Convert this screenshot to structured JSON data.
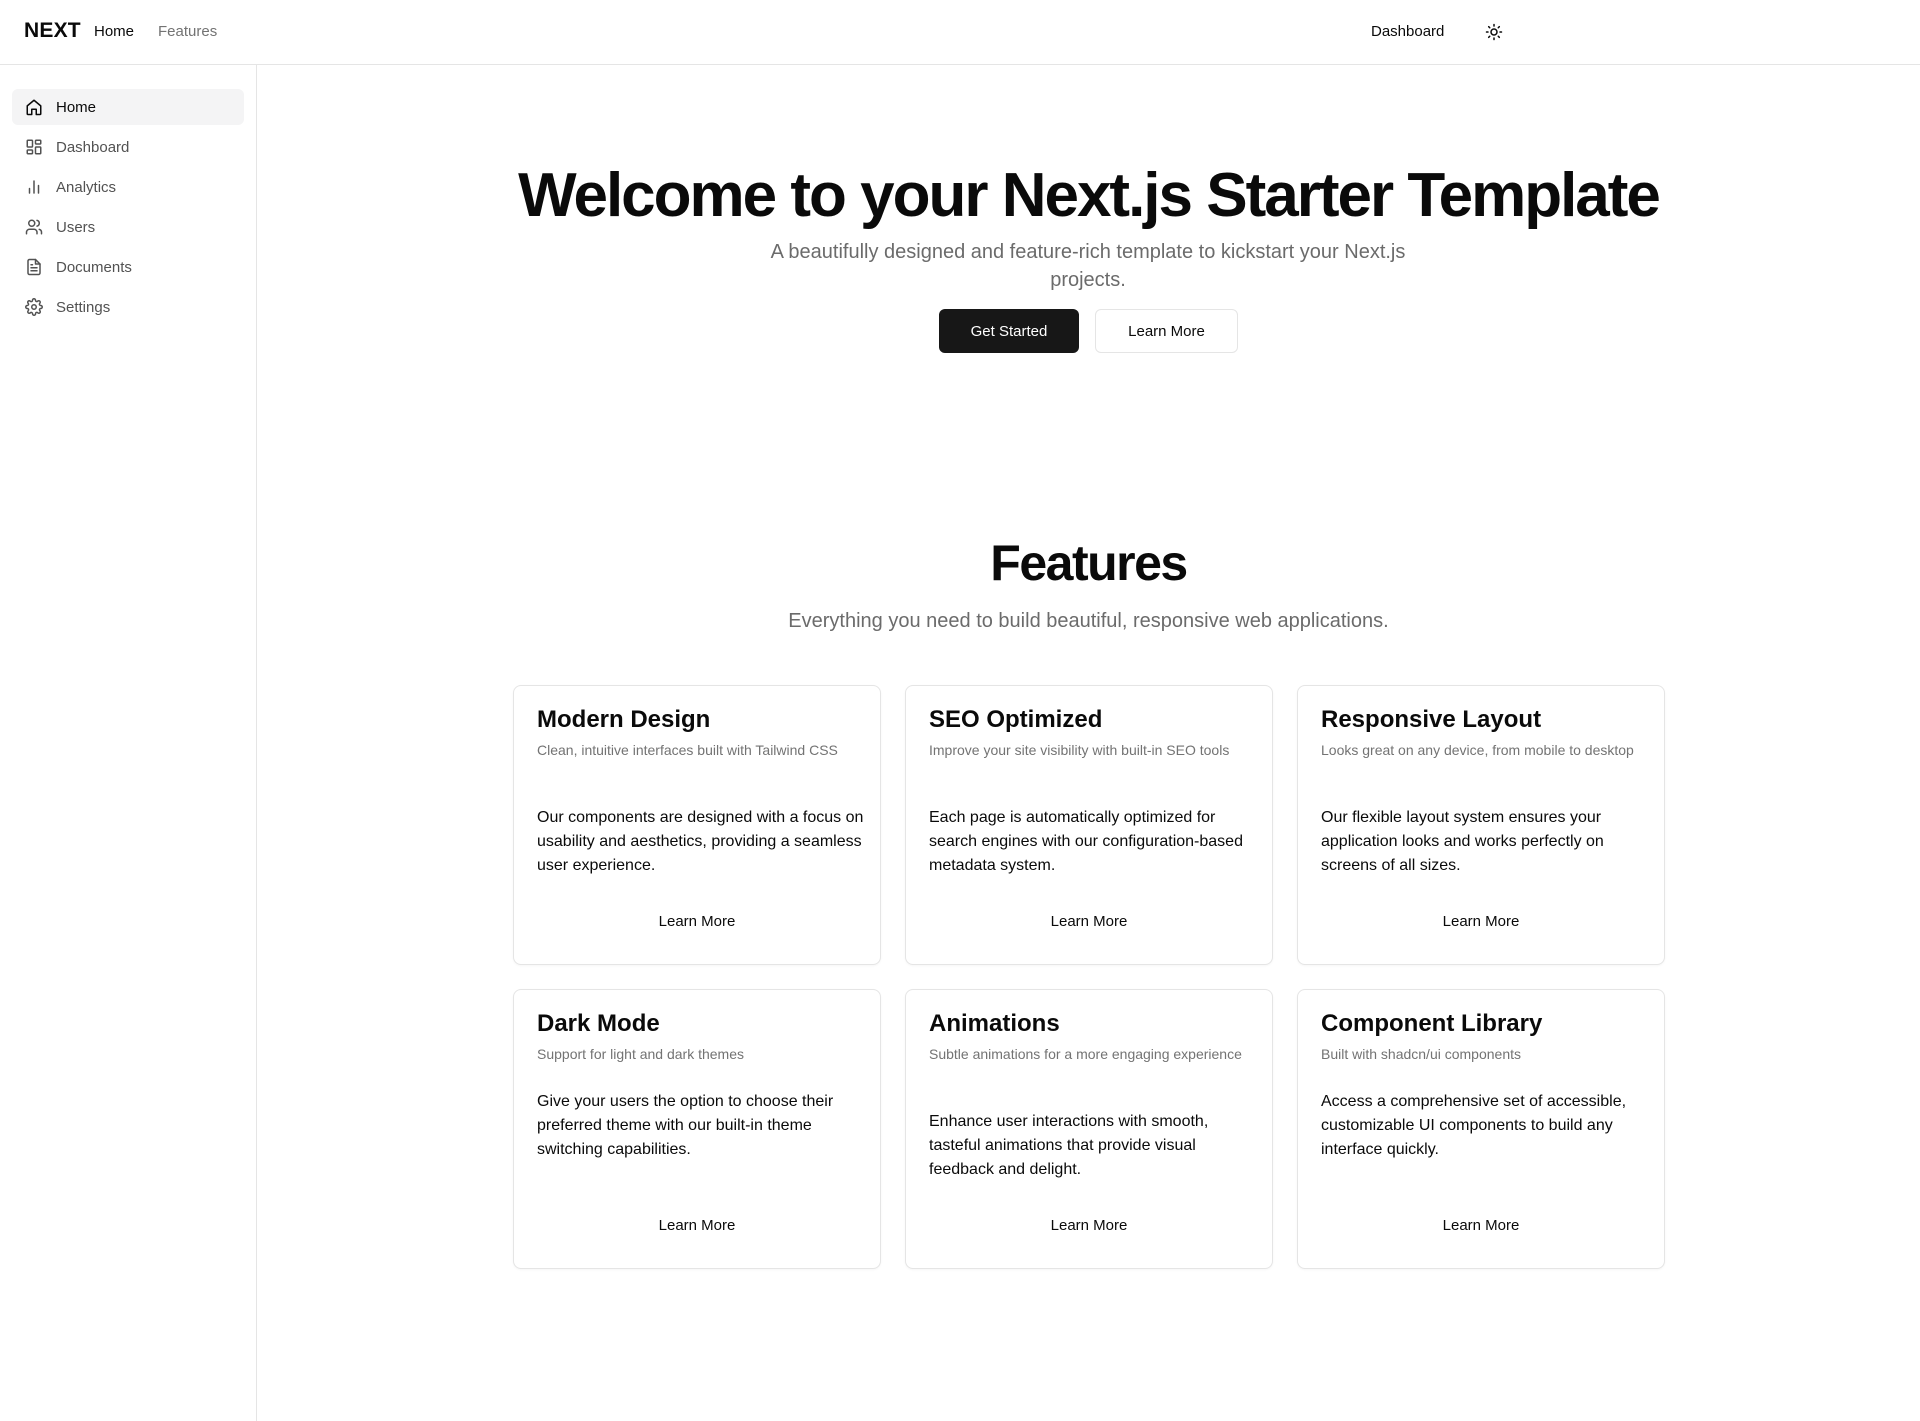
{
  "header": {
    "brand": "NEXT",
    "nav": [
      {
        "label": "Home"
      },
      {
        "label": "Features"
      }
    ],
    "dashboard_label": "Dashboard",
    "theme_icon": "sun-icon"
  },
  "sidebar": {
    "items": [
      {
        "label": "Home",
        "icon": "home-icon",
        "active": true
      },
      {
        "label": "Dashboard",
        "icon": "layout-grid-icon",
        "active": false
      },
      {
        "label": "Analytics",
        "icon": "bar-chart-icon",
        "active": false
      },
      {
        "label": "Users",
        "icon": "users-icon",
        "active": false
      },
      {
        "label": "Documents",
        "icon": "file-text-icon",
        "active": false
      },
      {
        "label": "Settings",
        "icon": "gear-icon",
        "active": false
      }
    ]
  },
  "hero": {
    "title": "Welcome to your Next.js Starter Template",
    "subtitle": "A beautifully designed and feature-rich template to kickstart your Next.js projects.",
    "primary_cta": "Get Started",
    "secondary_cta": "Learn More"
  },
  "features": {
    "title": "Features",
    "subtitle": "Everything you need to build beautiful, responsive web applications.",
    "cards": [
      {
        "title": "Modern Design",
        "description": "Clean, intuitive interfaces built with Tailwind CSS",
        "body": "Our components are designed with a focus on usability and aesthetics, providing a seamless user experience.",
        "link": "Learn More"
      },
      {
        "title": "SEO Optimized",
        "description": "Improve your site visibility with built-in SEO tools",
        "body": "Each page is automatically optimized for search engines with our configuration-based metadata system.",
        "link": "Learn More"
      },
      {
        "title": "Responsive Layout",
        "description": "Looks great on any device, from mobile to desktop",
        "body": "Our flexible layout system ensures your application looks and works perfectly on screens of all sizes.",
        "link": "Learn More"
      },
      {
        "title": "Dark Mode",
        "description": "Support for light and dark themes",
        "body": "Give your users the option to choose their preferred theme with our built-in theme switching capabilities.",
        "link": "Learn More"
      },
      {
        "title": "Animations",
        "description": "Subtle animations for a more engaging experience",
        "body": "Enhance user interactions with smooth, tasteful animations that provide visual feedback and delight.",
        "link": "Learn More"
      },
      {
        "title": "Component Library",
        "description": "Built with shadcn/ui components",
        "body": "Access a comprehensive set of accessible, customizable UI components to build any interface quickly.",
        "link": "Learn More"
      }
    ]
  },
  "colors": {
    "primary": "#171717",
    "border": "#e5e5e5",
    "muted_text": "#737373",
    "active_bg": "#f4f4f5"
  }
}
